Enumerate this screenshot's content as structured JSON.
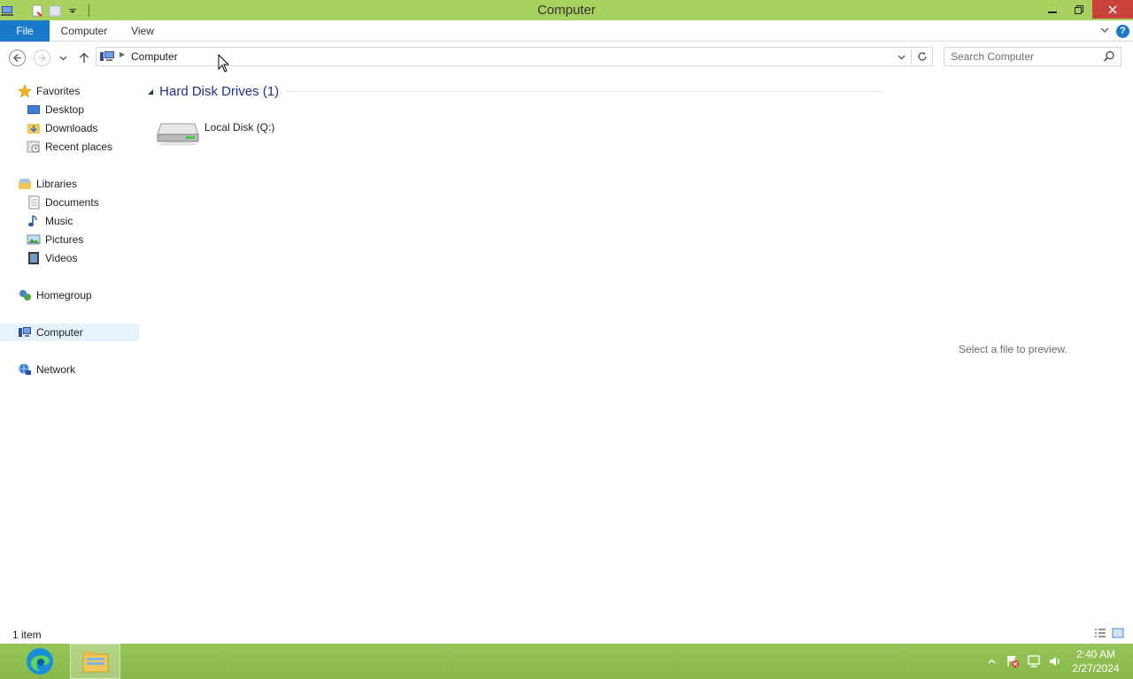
{
  "window": {
    "title": "Computer",
    "qat_icons": [
      "computer-icon",
      "properties-icon",
      "new-folder-icon",
      "customize-qat-icon"
    ],
    "controls": [
      "minimize-icon",
      "restore-icon",
      "close-icon"
    ]
  },
  "ribbon": {
    "tabs": [
      {
        "label": "File"
      },
      {
        "label": "Computer"
      },
      {
        "label": "View"
      }
    ],
    "help_icon": "help-icon"
  },
  "address": {
    "crumbs": [
      "Computer"
    ],
    "search_placeholder": "Search Computer"
  },
  "nav": {
    "favorites": {
      "label": "Favorites",
      "items": [
        "Desktop",
        "Downloads",
        "Recent places"
      ]
    },
    "libraries": {
      "label": "Libraries",
      "items": [
        "Documents",
        "Music",
        "Pictures",
        "Videos"
      ]
    },
    "homegroup": "Homegroup",
    "computer": "Computer",
    "network": "Network"
  },
  "content": {
    "group_title": "Hard Disk Drives (1)",
    "drives": [
      {
        "name": "Local Disk (Q:)"
      }
    ],
    "preview_text": "Select a file to preview."
  },
  "status": {
    "item_count": "1 item"
  },
  "taskbar": {
    "apps": [
      "edge-icon",
      "file-explorer-icon"
    ],
    "clock_time": "2:40 AM",
    "clock_date": "2/27/2024"
  },
  "colors": {
    "titlebar": "#a9d15f",
    "file_tab": "#1979ca",
    "group_title": "#1e3287",
    "close_button": "#c8413a",
    "taskbar": "#8fbf4f"
  }
}
